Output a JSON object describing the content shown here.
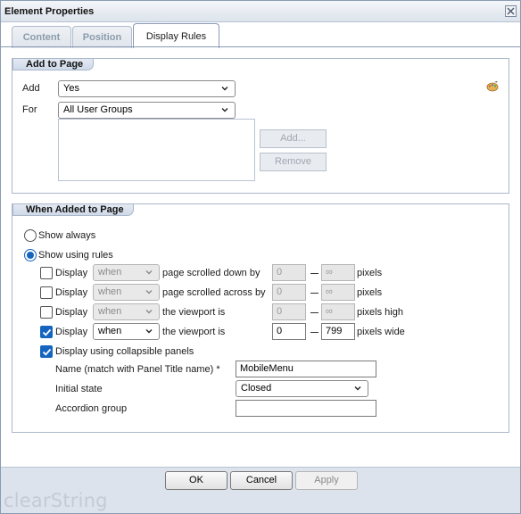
{
  "window": {
    "title": "Element Properties"
  },
  "tabs": [
    {
      "label": "Content",
      "active": false
    },
    {
      "label": "Position",
      "active": false
    },
    {
      "label": "Display Rules",
      "active": true
    }
  ],
  "add_to_page": {
    "heading": "Add to Page",
    "add_label": "Add",
    "add_value": "Yes",
    "for_label": "For",
    "for_value": "All User Groups",
    "add_button": "Add...",
    "remove_button": "Remove",
    "icon": "palette-icon"
  },
  "when_added": {
    "heading": "When Added to Page",
    "show_always": "Show always",
    "show_rules": "Show using rules",
    "selected": "Show using rules",
    "rules": [
      {
        "checked": false,
        "label": "Display",
        "when": "when",
        "condition": "page scrolled down by",
        "from": "0",
        "to": "∞",
        "unit": "pixels",
        "enabled": false
      },
      {
        "checked": false,
        "label": "Display",
        "when": "when",
        "condition": "page scrolled across by",
        "from": "0",
        "to": "∞",
        "unit": "pixels",
        "enabled": false
      },
      {
        "checked": false,
        "label": "Display",
        "when": "when",
        "condition": "the viewport is",
        "from": "0",
        "to": "∞",
        "unit": "pixels high",
        "enabled": false
      },
      {
        "checked": true,
        "label": "Display",
        "when": "when",
        "condition": "the viewport is",
        "from": "0",
        "to": "799",
        "unit": "pixels wide",
        "enabled": true
      }
    ],
    "collapsible": {
      "checked": true,
      "label": "Display using collapsible panels",
      "name_label": "Name (match with Panel Title name) *",
      "name_value": "MobileMenu",
      "state_label": "Initial state",
      "state_value": "Closed",
      "group_label": "Accordion group",
      "group_value": ""
    }
  },
  "footer": {
    "ok": "OK",
    "cancel": "Cancel",
    "apply": "Apply",
    "brand": "clearString"
  },
  "colors": {
    "accent": "#1565c0",
    "frame": "#8a9bb3",
    "footer_bg": "#dde3ec"
  }
}
